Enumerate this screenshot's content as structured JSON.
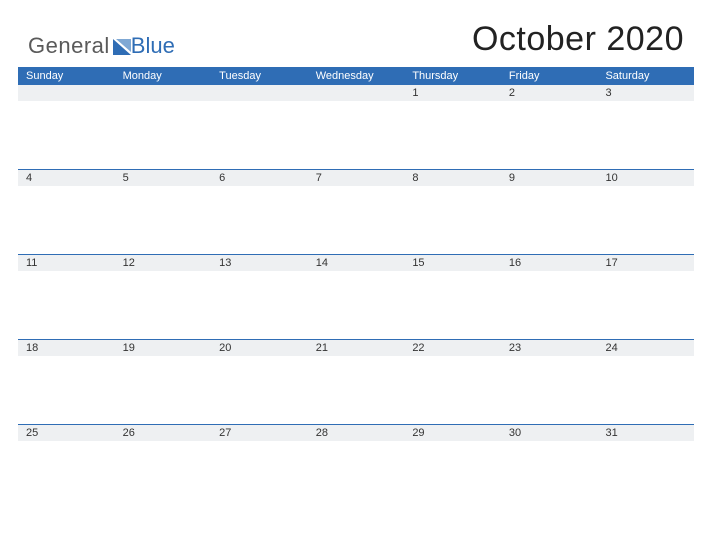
{
  "brand": {
    "word1": "General",
    "word2": "Blue"
  },
  "title": "October 2020",
  "colors": {
    "accent": "#2f6db5",
    "band": "#eef0f2"
  },
  "day_names": [
    "Sunday",
    "Monday",
    "Tuesday",
    "Wednesday",
    "Thursday",
    "Friday",
    "Saturday"
  ],
  "weeks": [
    [
      "",
      "",
      "",
      "",
      "1",
      "2",
      "3"
    ],
    [
      "4",
      "5",
      "6",
      "7",
      "8",
      "9",
      "10"
    ],
    [
      "11",
      "12",
      "13",
      "14",
      "15",
      "16",
      "17"
    ],
    [
      "18",
      "19",
      "20",
      "21",
      "22",
      "23",
      "24"
    ],
    [
      "25",
      "26",
      "27",
      "28",
      "29",
      "30",
      "31"
    ]
  ]
}
